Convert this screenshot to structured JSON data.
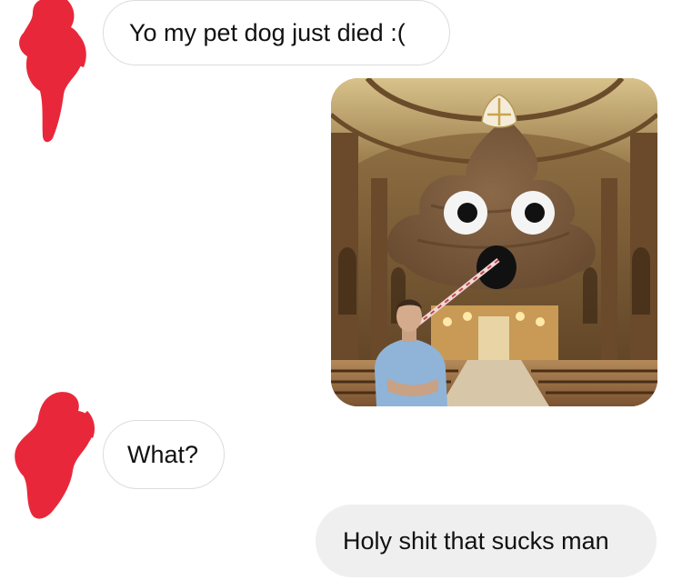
{
  "conversation": {
    "messages": [
      {
        "direction": "incoming",
        "type": "text",
        "text": "Yo my pet dog just died :("
      },
      {
        "direction": "outgoing",
        "type": "image",
        "image_icon": "photo-icon"
      },
      {
        "direction": "incoming",
        "type": "text",
        "text": "What?"
      },
      {
        "direction": "outgoing",
        "type": "text",
        "text": "Holy shit that sucks man"
      }
    ]
  },
  "colors": {
    "background": "#ffffff",
    "incoming_bubble": "#ffffff",
    "incoming_border": "#dcdcdc",
    "outgoing_bubble": "#efefef",
    "redaction": "#e8283a",
    "text": "#111111"
  }
}
